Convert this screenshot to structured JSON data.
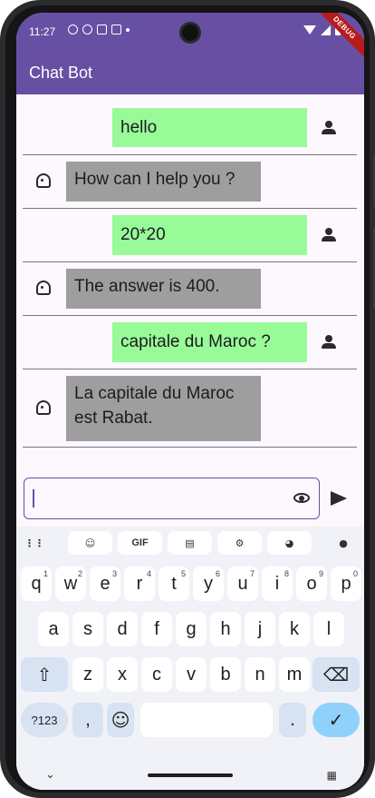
{
  "status_bar": {
    "time": "11:27",
    "debug_banner": "DEBUG"
  },
  "app_bar": {
    "title": "Chat Bot",
    "color": "#6750a4"
  },
  "messages": [
    {
      "sender": "user",
      "text": "hello"
    },
    {
      "sender": "bot",
      "text": "How can I help you ?"
    },
    {
      "sender": "user",
      "text": "20*20"
    },
    {
      "sender": "bot",
      "text": "The answer is 400."
    },
    {
      "sender": "user",
      "text": "capitale du Maroc ?"
    },
    {
      "sender": "bot",
      "text": "La capitale du Maroc est Rabat."
    }
  ],
  "colors": {
    "user_bubble": "#98fb98",
    "bot_bubble": "#9e9e9e"
  },
  "input": {
    "value": "",
    "placeholder": ""
  },
  "keyboard": {
    "toolbar": [
      "grid-icon",
      "sticker-icon",
      "GIF",
      "clipboard-icon",
      "gear-icon",
      "palette-icon",
      "mic-icon"
    ],
    "row1": [
      {
        "k": "q",
        "n": "1"
      },
      {
        "k": "w",
        "n": "2"
      },
      {
        "k": "e",
        "n": "3"
      },
      {
        "k": "r",
        "n": "4"
      },
      {
        "k": "t",
        "n": "5"
      },
      {
        "k": "y",
        "n": "6"
      },
      {
        "k": "u",
        "n": "7"
      },
      {
        "k": "i",
        "n": "8"
      },
      {
        "k": "o",
        "n": "9"
      },
      {
        "k": "p",
        "n": "0"
      }
    ],
    "row2": [
      "a",
      "s",
      "d",
      "f",
      "g",
      "h",
      "j",
      "k",
      "l"
    ],
    "row3": [
      "z",
      "x",
      "c",
      "v",
      "b",
      "n",
      "m"
    ],
    "bottom": {
      "symbols": "?123",
      "comma": ",",
      "period": "."
    }
  }
}
